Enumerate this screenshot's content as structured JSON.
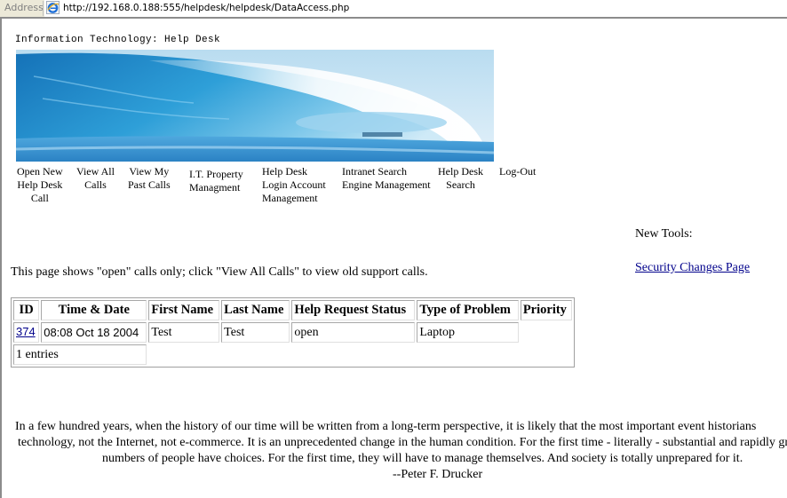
{
  "browser": {
    "address_label": "Address",
    "url": "http://192.168.0.188:555/helpdesk/helpdesk/DataAccess.php",
    "page_icon": "ie-page-icon"
  },
  "header": {
    "title": "Information Technology: Help Desk",
    "banner_alt": "ocean-wave-banner"
  },
  "nav": [
    {
      "lines": [
        "Open New",
        "Help Desk",
        "Call"
      ]
    },
    {
      "lines": [
        "View All",
        "Calls"
      ]
    },
    {
      "lines": [
        "View My",
        "Past Calls"
      ]
    },
    {
      "lines": [
        "I.T. Property",
        "Managment"
      ]
    },
    {
      "lines": [
        "Help Desk",
        "Login Account",
        "Management"
      ]
    },
    {
      "lines": [
        "Intranet Search",
        "Engine Management"
      ]
    },
    {
      "lines": [
        "Help Desk",
        "Search"
      ]
    },
    {
      "lines": [
        "Log-Out"
      ]
    }
  ],
  "sidebar": {
    "new_tools_label": "New Tools:",
    "security_link": "Security Changes Page"
  },
  "notice": "This page shows \"open\" calls only; click \"View All Calls\" to view old support calls.",
  "table": {
    "headers": [
      "ID",
      "Time & Date",
      "First Name",
      "Last Name",
      "Help Request Status",
      "Type of Problem",
      "Priority"
    ],
    "rows": [
      {
        "id": "374",
        "time": "08:08 Oct 18 2004",
        "first": "Test",
        "last": "Test",
        "status": "open",
        "type": "Laptop",
        "priority": ""
      }
    ],
    "entries": "1 entries"
  },
  "quote": {
    "line1": "In a few hundred years, when the history of our time will be written from a long-term perspective, it is likely that the most important event historians",
    "line2": "technology, not the Internet, not e-commerce. It is an unprecedented change in the human condition. For the first time - literally - substantial and rapidly growing",
    "line3": "numbers of people have choices. For the first time, they will have to manage themselves. And society is totally unprepared for it.",
    "author": "--Peter F. Drucker"
  }
}
